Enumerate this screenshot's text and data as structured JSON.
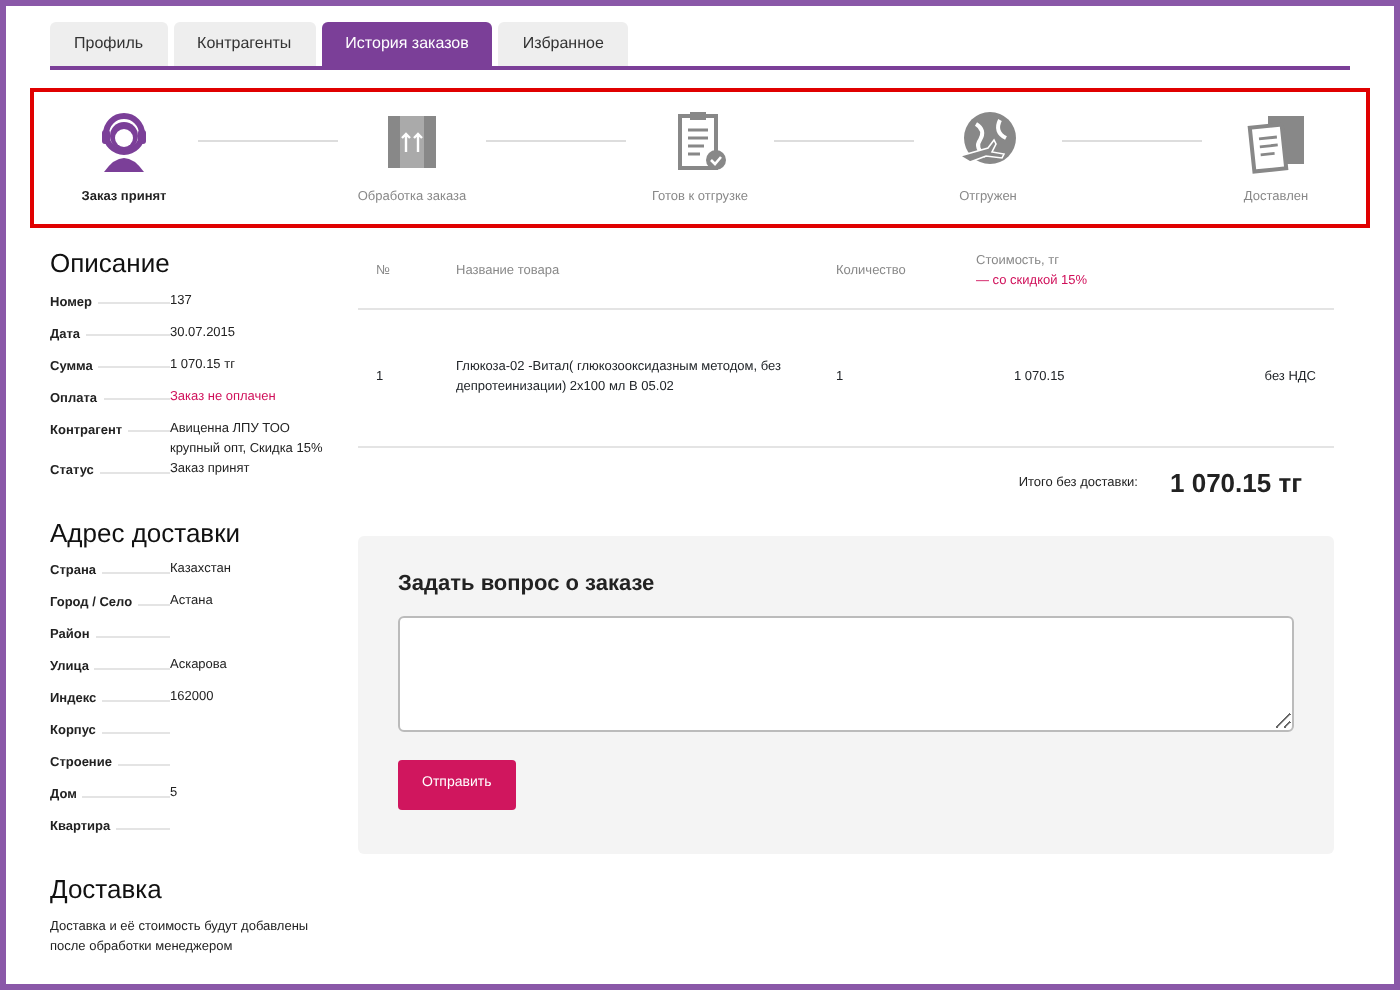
{
  "tabs": [
    {
      "label": "Профиль",
      "selected": false
    },
    {
      "label": "Контрагенты",
      "selected": false
    },
    {
      "label": "История заказов",
      "selected": true
    },
    {
      "label": "Избранное",
      "selected": false
    }
  ],
  "steps": [
    {
      "kind": "headset",
      "label": "Заказ принят",
      "active": true
    },
    {
      "kind": "box",
      "label": "Обработка заказа",
      "active": false
    },
    {
      "kind": "clipboard",
      "label": "Готов к отгрузке",
      "active": false
    },
    {
      "kind": "globe",
      "label": "Отгружен",
      "active": false
    },
    {
      "kind": "delivered",
      "label": "Доставлен",
      "active": false
    }
  ],
  "description": {
    "title": "Описание",
    "fields": [
      {
        "label": "Номер",
        "value": "137",
        "alert": false
      },
      {
        "label": "Дата",
        "value": "30.07.2015",
        "alert": false
      },
      {
        "label": "Сумма",
        "value": "1 070.15 тг",
        "alert": false
      },
      {
        "label": "Оплата",
        "value": "Заказ не оплачен",
        "alert": true
      },
      {
        "label": "Контрагент",
        "value": "Авиценна ЛПУ ТОО крупный опт, Скидка 15%",
        "alert": false
      },
      {
        "label": "Статус",
        "value": "Заказ принят",
        "alert": false
      }
    ]
  },
  "address": {
    "title": "Адрес доставки",
    "fields": [
      {
        "label": "Страна",
        "value": "Казахстан"
      },
      {
        "label": "Город / Село",
        "value": "Астана"
      },
      {
        "label": "Район"
      },
      {
        "label": "Улица",
        "value": "Аскарова"
      },
      {
        "label": "Индекс",
        "value": "162000"
      },
      {
        "label": "Корпус"
      },
      {
        "label": "Строение"
      },
      {
        "label": "Дом",
        "value": "5"
      },
      {
        "label": "Квартира"
      }
    ]
  },
  "delivery": {
    "title": "Доставка",
    "text": "Доставка и её стоимость будут добавлены после обработки менеджером"
  },
  "table": {
    "columns": [
      {
        "label": "№"
      },
      {
        "label": "Название товара"
      },
      {
        "label": "Количество"
      },
      {
        "label": "Стоимость, тг",
        "note": "— со скидкой 15%"
      }
    ],
    "rows": [
      [
        "1",
        "Глюкоза-02 -Витал( глюкозооксидазным методом, без депротеинизации) 2х100 мл В 05.02",
        "1",
        "1 070.15",
        "без НДС"
      ]
    ]
  },
  "total": {
    "label": "Итого без доставки:",
    "value": "1 070.15 тг"
  },
  "question": {
    "title": "Задать вопрос о заказе",
    "button": "Отправить"
  }
}
